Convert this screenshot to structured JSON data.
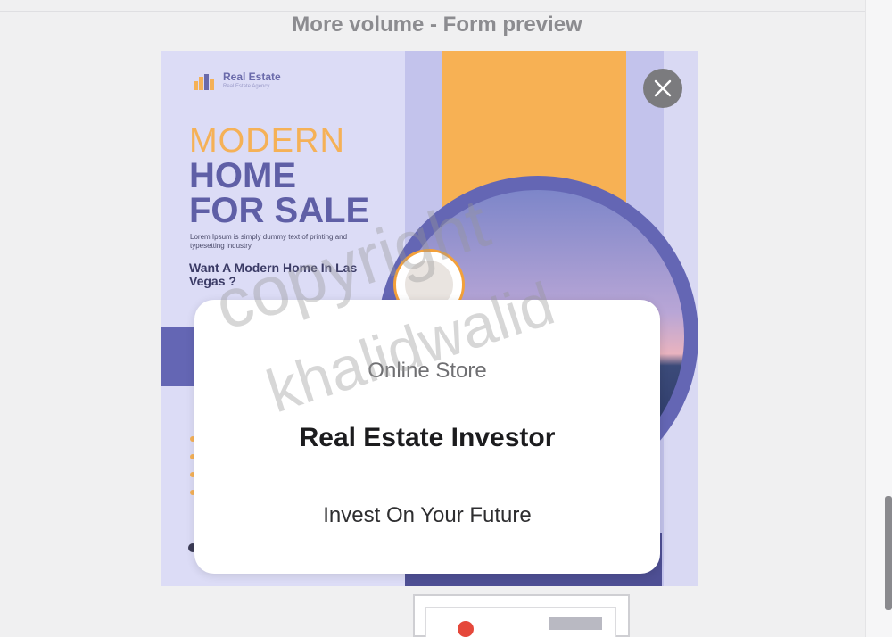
{
  "header": {
    "title": "More volume - Form preview"
  },
  "ad": {
    "logo": {
      "name": "Real Estate",
      "tagline": "Real Estate Agency"
    },
    "headline_1": "MODERN",
    "headline_2": "HOME",
    "headline_3": "FOR SALE",
    "body": "Lorem Ipsum is simply dummy text of printing and typesetting industry.",
    "question": "Want A Modern Home In Las Vegas ?",
    "colors": {
      "orange": "#f5b157",
      "purple": "#5f5fa6",
      "lavender": "#dcdcf6"
    }
  },
  "form_card": {
    "store_label": "Online Store",
    "title": "Real Estate Investor",
    "tagline": "Invest On Your Future"
  },
  "watermark": {
    "line_1": "copyright",
    "line_2": "khalidwalid"
  },
  "controls": {
    "close_icon": "close-icon"
  }
}
